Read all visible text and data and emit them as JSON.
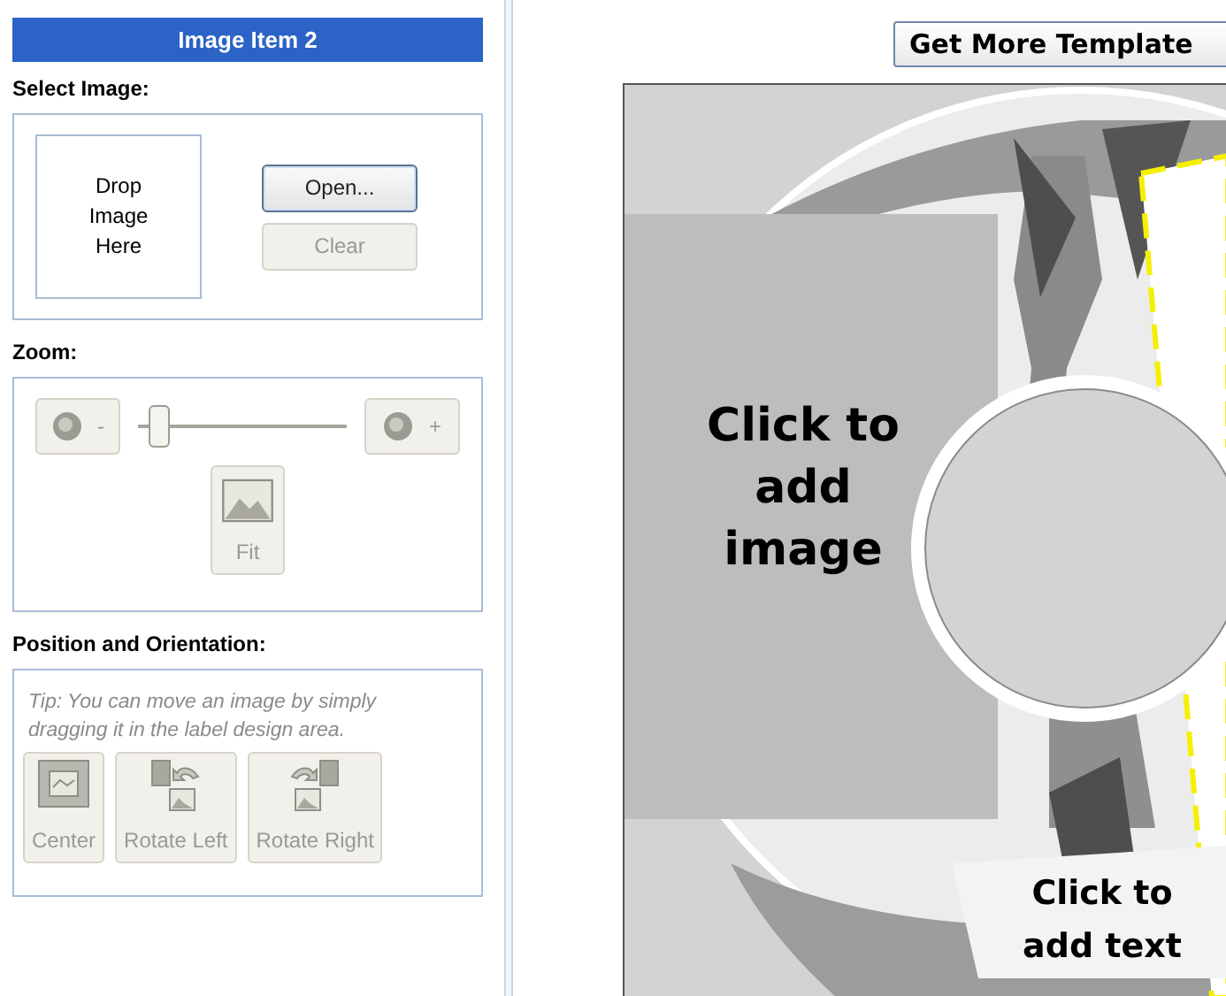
{
  "panel": {
    "title": "Image Item 2",
    "select_image": {
      "heading": "Select Image:",
      "drop_zone": "Drop Image Here",
      "buttons": [
        {
          "label": "Open...",
          "disabled": false
        },
        {
          "label": "Clear",
          "disabled": true
        }
      ]
    },
    "zoom": {
      "heading": "Zoom:",
      "zoom_out": {
        "label": "-",
        "disabled": true
      },
      "zoom_in": {
        "label": "+",
        "disabled": true
      },
      "slider": {
        "level": 0.1
      },
      "fit": {
        "label": "Fit",
        "disabled": true
      }
    },
    "position": {
      "heading": "Position and Orientation:",
      "tip": "Tip: You can move an image by simply dragging it in the label design area.",
      "buttons": [
        {
          "kind": "center",
          "label": "Center",
          "disabled": true
        },
        {
          "kind": "rotate_left",
          "label": "Rotate Left",
          "disabled": true
        },
        {
          "kind": "rotate_right",
          "label": "Rotate Right",
          "disabled": true
        }
      ]
    }
  },
  "design": {
    "templates_button": "Get More Template",
    "image_placeholder": "Click to add image",
    "text_placeholder": "Click to add text"
  }
}
